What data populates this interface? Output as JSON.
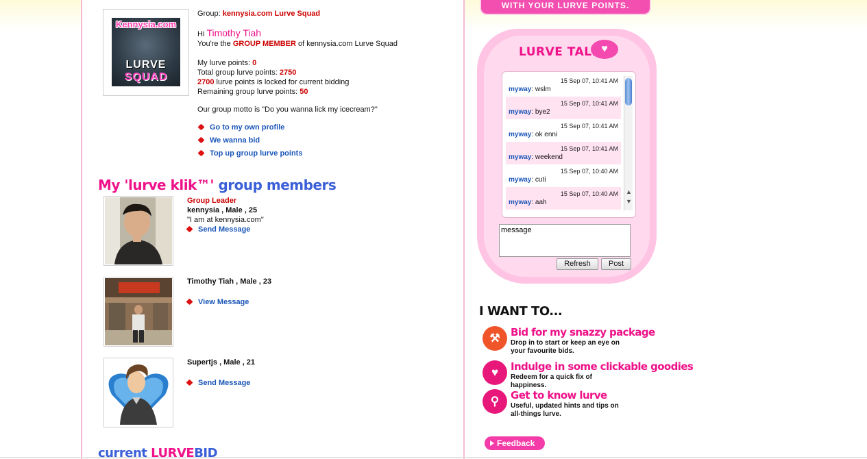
{
  "colors": {
    "pink": "#ee1188",
    "red": "#cc0000",
    "link_blue": "#1b56b8",
    "title_blue": "#3a5fd8",
    "bubble_pink": "#ffc3e3"
  },
  "group": {
    "logo": {
      "top": "Kennysia.com",
      "line1": "LURVE",
      "line2": "SQUAD"
    },
    "label": "Group:",
    "name": "kennysia.com Lurve Squad",
    "hi": "Hi",
    "user": "Timothy Tiah",
    "member_prefix": "You're the",
    "member_role": "GROUP MEMBER",
    "member_suffix": "of kennysia.com Lurve Squad",
    "my_points_label": "My lurve points:",
    "my_points": "0",
    "total_label": "Total group lurve points:",
    "total": "2750",
    "locked": "2700",
    "locked_suffix": "lurve points is locked for current bidding",
    "remaining_label": "Remaining group lurve points:",
    "remaining": "50",
    "motto": "Our group motto is \"Do you wanna lick my icecream?\"",
    "links": [
      "Go to my own profile",
      "We wanna bid",
      "Top up group lurve points"
    ]
  },
  "members_title": {
    "part1": "My 'lurve klik™'",
    "part2": "group members"
  },
  "members": [
    {
      "role": "Group Leader",
      "name": "kennysia , Male , 25",
      "quote": "\"I am at kennysia.com\"",
      "action": "Send Message"
    },
    {
      "role": "",
      "name": "Timothy Tiah , Male , 23",
      "quote": "",
      "action": "View Message"
    },
    {
      "role": "",
      "name": "Supertjs , Male , 21",
      "quote": "",
      "action": "Send Message"
    }
  ],
  "current_bid": {
    "part1": "current",
    "part2": "LURVE",
    "part3": "BID"
  },
  "banner": "WITH YOUR LURVE POINTS.",
  "chat": {
    "title": "LURVE TALKS",
    "messages": [
      {
        "time": "15 Sep 07, 10:41 AM",
        "user": "myway",
        "text": ": wslm"
      },
      {
        "time": "15 Sep 07, 10:41 AM",
        "user": "myway",
        "text": ": bye2"
      },
      {
        "time": "15 Sep 07, 10:41 AM",
        "user": "myway",
        "text": ": ok enni"
      },
      {
        "time": "15 Sep 07, 10:41 AM",
        "user": "myway",
        "text": ": weekend"
      },
      {
        "time": "15 Sep 07, 10:40 AM",
        "user": "myway",
        "text": ": cuti"
      },
      {
        "time": "15 Sep 07, 10:40 AM",
        "user": "myway",
        "text": ": aah"
      }
    ],
    "input_value": "message",
    "refresh": "Refresh",
    "post": "Post"
  },
  "want": {
    "title": "I WANT TO...",
    "items": [
      {
        "icon": "gavel-icon",
        "head": "Bid for my snazzy package",
        "desc": "Drop in to start or keep an eye on your favourite bids.",
        "color": "#f0552a"
      },
      {
        "icon": "cart-icon",
        "head": "Indulge in some clickable goodies",
        "desc": "Redeem for a quick fix of happiness.",
        "color": "#e8187a"
      },
      {
        "icon": "magnifier-icon",
        "head": "Get to know lurve",
        "desc": "Useful, updated hints and tips on all-things lurve.",
        "color": "#e8187a"
      }
    ]
  },
  "feedback": "Feedback"
}
